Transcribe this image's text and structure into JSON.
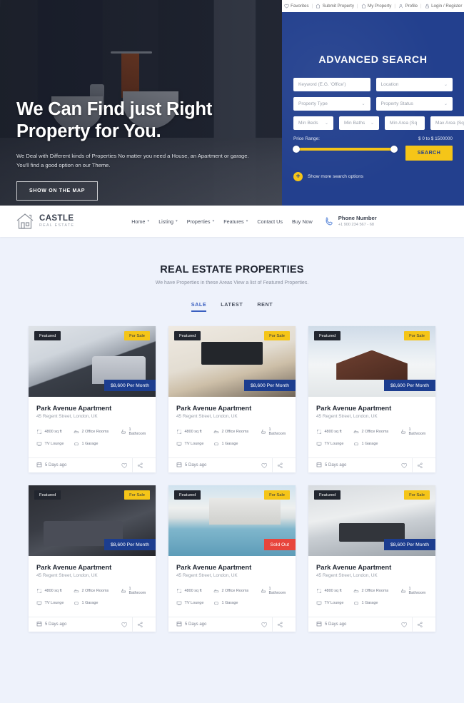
{
  "topbar": {
    "items": [
      {
        "label": "Favorites",
        "icon": "heart-icon"
      },
      {
        "label": "Submit Property",
        "icon": "home-icon"
      },
      {
        "label": "My Property",
        "icon": "home-icon"
      },
      {
        "label": "Profile",
        "icon": "user-icon"
      },
      {
        "label": "Login / Register",
        "icon": "lock-icon"
      }
    ],
    "separator": "|"
  },
  "hero": {
    "title_line1": "We Can Find just Right",
    "title_line2": "Property for You.",
    "subtitle_line1": "We Deal with Different kinds of Properties No matter you need a House, an Apartment or garage.",
    "subtitle_line2": "You'll find a good option on our Theme.",
    "button_label": "SHOW ON THE MAP"
  },
  "search": {
    "title": "ADVANCED SEARCH",
    "keyword_placeholder": "Keyword (E.G. 'Office')",
    "location_placeholder": "Location",
    "property_type_placeholder": "Property Type",
    "property_status_placeholder": "Property Status",
    "min_beds_placeholder": "Min Beds",
    "min_baths_placeholder": "Min Baths",
    "min_area_placeholder": "Min Area (Sq ",
    "max_area_placeholder": "Max Area (Sq ",
    "price_range_label": "Price Range:",
    "price_range_value": "$ 0 to $ 1500000",
    "search_button": "SEARCH",
    "more_options_label": "Show more search options",
    "plus_glyph": "+",
    "caret_glyph": "⌄",
    "accent_color": "#f5c518",
    "panel_color": "#23408e"
  },
  "nav": {
    "brand_name": "CASTLE",
    "brand_sub": "REAL ESTATE",
    "items": [
      {
        "label": "Home",
        "has_caret": true
      },
      {
        "label": "Listing",
        "has_caret": true
      },
      {
        "label": "Properties",
        "has_caret": true
      },
      {
        "label": "Features",
        "has_caret": true
      },
      {
        "label": "Contact Us",
        "has_caret": false
      },
      {
        "label": "Buy Now",
        "has_caret": false
      }
    ],
    "phone_label": "Phone Number",
    "phone_number": "+1 900 234 567 - 68"
  },
  "section": {
    "title": "REAL ESTATE PROPERTIES",
    "subtitle": "We have Properties in these Areas View a list of Featured Properties.",
    "tabs": [
      {
        "label": "SALE",
        "active": true
      },
      {
        "label": "LATEST",
        "active": false
      },
      {
        "label": "RENT",
        "active": false
      }
    ]
  },
  "cards": [
    {
      "featured": "Featured",
      "status": "For Sale",
      "price": "$8,600 Per Month",
      "sold": false,
      "title": "Park Avenue Apartment",
      "address": "45 Regent Street, London, UK",
      "features": [
        "4800 sq ft",
        "2 Office Rooms",
        "1 Bathroom",
        "TV Lounge",
        "1 Garage"
      ],
      "ago": "5 Days ago"
    },
    {
      "featured": "Featured",
      "status": "For Sale",
      "price": "$8,600 Per Month",
      "sold": false,
      "title": "Park Avenue Apartment",
      "address": "45 Regent Street, London, UK",
      "features": [
        "4800 sq ft",
        "2 Office Rooms",
        "1 Bathroom",
        "TV Lounge",
        "1 Garage"
      ],
      "ago": "5 Days ago"
    },
    {
      "featured": "Featured",
      "status": "For Sale",
      "price": "$8,600 Per Month",
      "sold": false,
      "title": "Park Avenue Apartment",
      "address": "45 Regent Street, London, UK",
      "features": [
        "4800 sq ft",
        "2 Office Rooms",
        "1 Bathroom",
        "TV Lounge",
        "1 Garage"
      ],
      "ago": "5 Days ago"
    },
    {
      "featured": "Featured",
      "status": "For Sale",
      "price": "$8,600 Per Month",
      "sold": false,
      "title": "Park Avenue Apartment",
      "address": "45 Regent Street, London, UK",
      "features": [
        "4800 sq ft",
        "2 Office Rooms",
        "1 Bathroom",
        "TV Lounge",
        "1 Garage"
      ],
      "ago": "5 Days ago"
    },
    {
      "featured": "Featured",
      "status": "For Sale",
      "price": "Sold Out",
      "sold": true,
      "title": "Park Avenue Apartment",
      "address": "45 Regent Street, London, UK",
      "features": [
        "4800 sq ft",
        "2 Office Rooms",
        "1 Bathroom",
        "TV Lounge",
        "1 Garage"
      ],
      "ago": "5 Days ago"
    },
    {
      "featured": "Featured",
      "status": "For Sale",
      "price": "$8,600 Per Month",
      "sold": false,
      "title": "Park Avenue Apartment",
      "address": "45 Regent Street, London, UK",
      "features": [
        "4800 sq ft",
        "2 Office Rooms",
        "1 Bathroom",
        "TV Lounge",
        "1 Garage"
      ],
      "ago": "5 Days ago"
    }
  ]
}
